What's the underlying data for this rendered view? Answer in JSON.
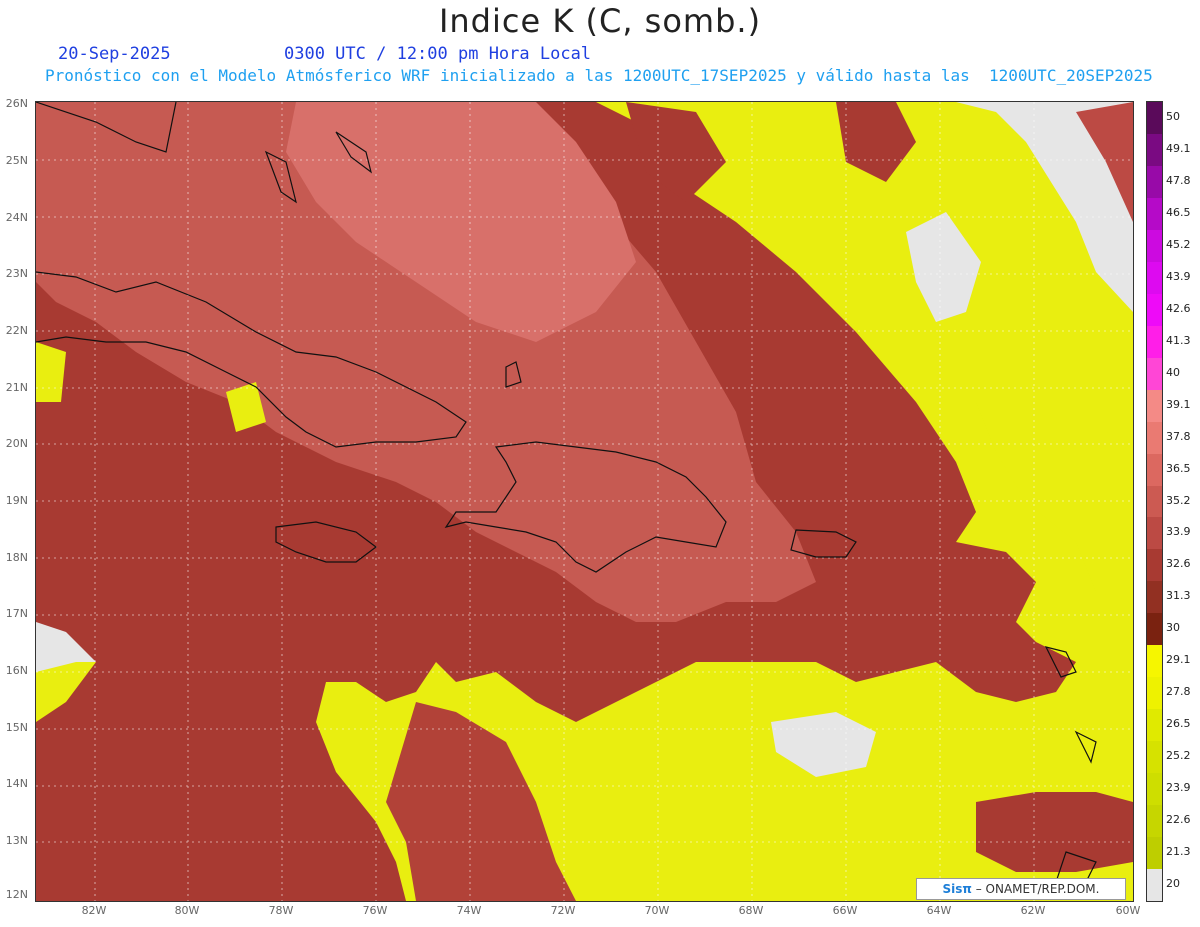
{
  "header": {
    "title": "Indice K (C, somb.)",
    "date": "20-Sep-2025",
    "time": "0300 UTC / 12:00 pm Hora Local",
    "info": "Pronóstico con el Modelo Atmósferico WRF inicializado a las 1200UTC_17SEP2025 y válido hasta las  1200UTC_20SEP2025"
  },
  "map": {
    "lat_labels": [
      "26N",
      "25N",
      "24N",
      "23N",
      "22N",
      "21N",
      "20N",
      "19N",
      "18N",
      "17N",
      "16N",
      "15N",
      "14N",
      "13N",
      "12N"
    ],
    "lon_labels": [
      "82W",
      "80W",
      "78W",
      "76W",
      "74W",
      "72W",
      "70W",
      "68W",
      "66W",
      "64W",
      "62W",
      "60W"
    ]
  },
  "legend": {
    "labels": [
      "50",
      "49.1",
      "47.8",
      "46.5",
      "45.2",
      "43.9",
      "42.6",
      "41.3",
      "40",
      "39.1",
      "37.8",
      "36.5",
      "35.2",
      "33.9",
      "32.6",
      "31.3",
      "30",
      "29.1",
      "27.8",
      "26.5",
      "25.2",
      "23.9",
      "22.6",
      "21.3",
      "20"
    ],
    "colors": [
      "#5a0a5a",
      "#7a0a82",
      "#980aa8",
      "#b50ac8",
      "#cc0ae0",
      "#dd0af0",
      "#ee0af8",
      "#ff1ee8",
      "#ff46d6",
      "#f48a86",
      "#ea7a72",
      "#dc6860",
      "#cc5a52",
      "#bc4a44",
      "#a83a32",
      "#923022",
      "#7a2210",
      "#f6f600",
      "#eef200",
      "#e0ea00",
      "#d6e200",
      "#cede00",
      "#c6d600",
      "#bece00",
      "#e6e6e6"
    ]
  },
  "credit": {
    "brand": "Sisπ",
    "org": " – ONAMET/REP.DOM."
  }
}
